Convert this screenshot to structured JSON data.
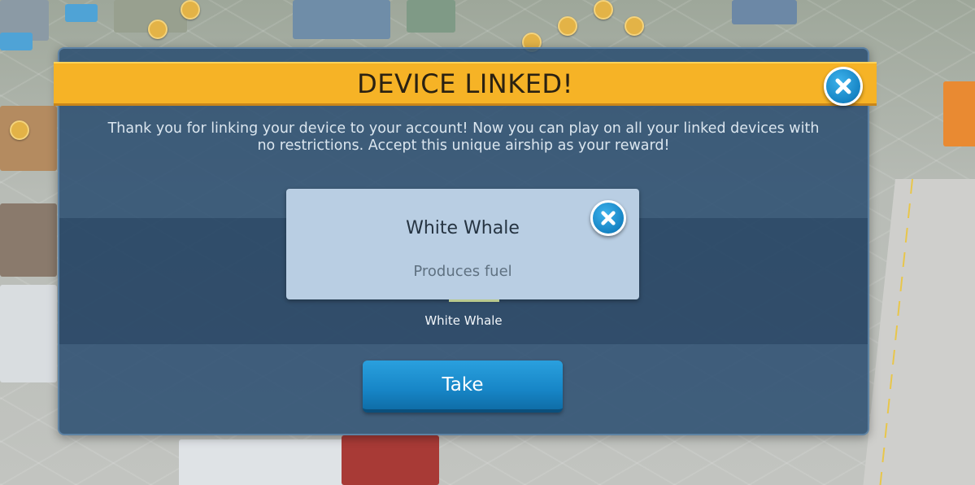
{
  "dialog": {
    "title": "DEVICE LINKED!",
    "message": "Thank you for linking your device to your account! Now you can play on all your linked devices with no restrictions. Accept this unique airship as your reward!",
    "close_icon": "close-icon"
  },
  "reward": {
    "card_title": "White Whale",
    "card_description": "Produces fuel",
    "item_label": "White Whale"
  },
  "actions": {
    "take_label": "Take"
  },
  "colors": {
    "banner": "#f6b326",
    "panel": "#2a4d70",
    "button": "#1786c7",
    "card": "#b9cee3"
  }
}
